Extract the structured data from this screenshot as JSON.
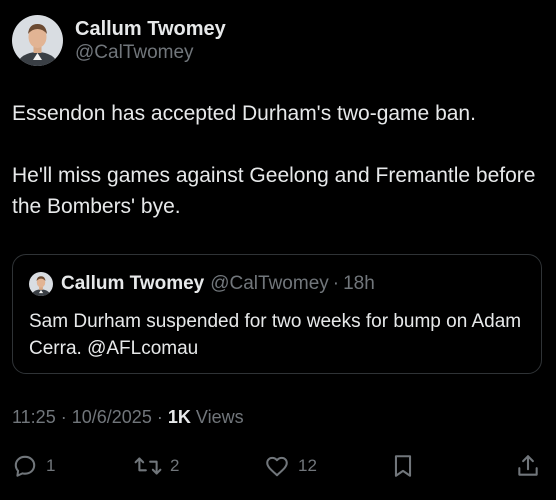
{
  "author": {
    "display_name": "Callum Twomey",
    "handle": "@CalTwomey"
  },
  "tweet": {
    "paragraphs": [
      "Essendon has accepted Durham's two-game ban.",
      "He'll miss games against Geelong and Fremantle before the Bombers' bye."
    ]
  },
  "quoted_tweet": {
    "display_name": "Callum Twomey",
    "handle": "@CalTwomey",
    "separator": "·",
    "time_ago": "18h",
    "text": "Sam Durham suspended for two weeks for bump on Adam Cerra. @AFLcomau"
  },
  "meta": {
    "time": "11:25",
    "separator": "·",
    "date": "10/6/2025",
    "views_count": "1K",
    "views_label": "Views"
  },
  "actions": {
    "reply_count": "1",
    "retweet_count": "2",
    "like_count": "12",
    "icons": [
      "reply-icon",
      "retweet-icon",
      "like-icon",
      "bookmark-icon",
      "share-icon"
    ]
  },
  "colors": {
    "background": "#000000",
    "text_primary": "#e7e9ea",
    "text_secondary": "#71767b",
    "border": "#2f3336"
  }
}
